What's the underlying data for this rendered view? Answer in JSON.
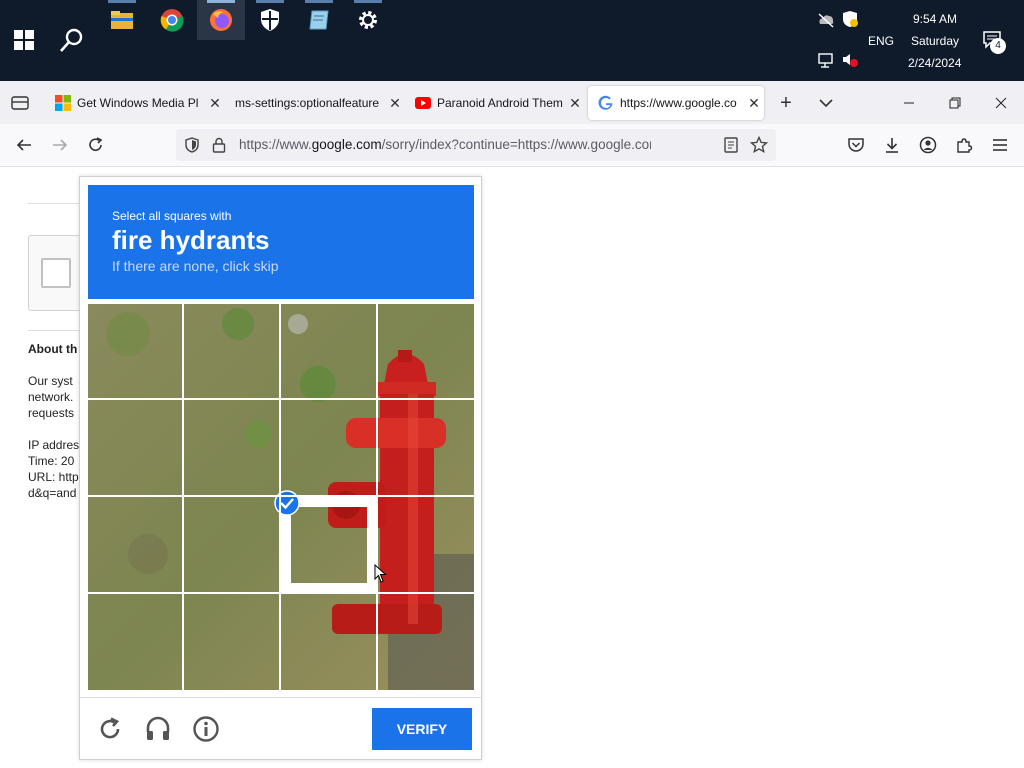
{
  "taskbar": {
    "pinned": [
      "file-explorer-icon",
      "chrome-icon",
      "firefox-icon",
      "security-icon",
      "notepad-icon",
      "settings-icon"
    ],
    "tray": {
      "lang": "ENG",
      "time": "9:54 AM",
      "day": "Saturday",
      "date": "2/24/2024",
      "notifications": "4"
    }
  },
  "browser": {
    "tabs": [
      {
        "title": "Get Windows Media Pl",
        "icon": "windows-icon"
      },
      {
        "title": "ms-settings:optionalfeature",
        "icon": "none"
      },
      {
        "title": "Paranoid Android Them",
        "icon": "youtube-icon"
      },
      {
        "title": "https://www.google.co",
        "icon": "google-icon",
        "active": true
      }
    ],
    "url": {
      "prefix": "https://www.",
      "domain": "google.com",
      "rest": "/sorry/index?continue=https://www.google.com/search"
    }
  },
  "page": {
    "about": "About th",
    "lines": [
      "Our syst",
      "network.",
      "requests",
      "",
      "IP addres",
      "Time: 20",
      "URL: http",
      "d&q=and"
    ]
  },
  "captcha": {
    "instruction": "Select all squares with",
    "target": "fire hydrants",
    "hint": "If there are none, click skip",
    "grid_size": 4,
    "selected_tiles": [
      10
    ],
    "verify_label": "VERIFY",
    "accent": "#1a73e8"
  }
}
